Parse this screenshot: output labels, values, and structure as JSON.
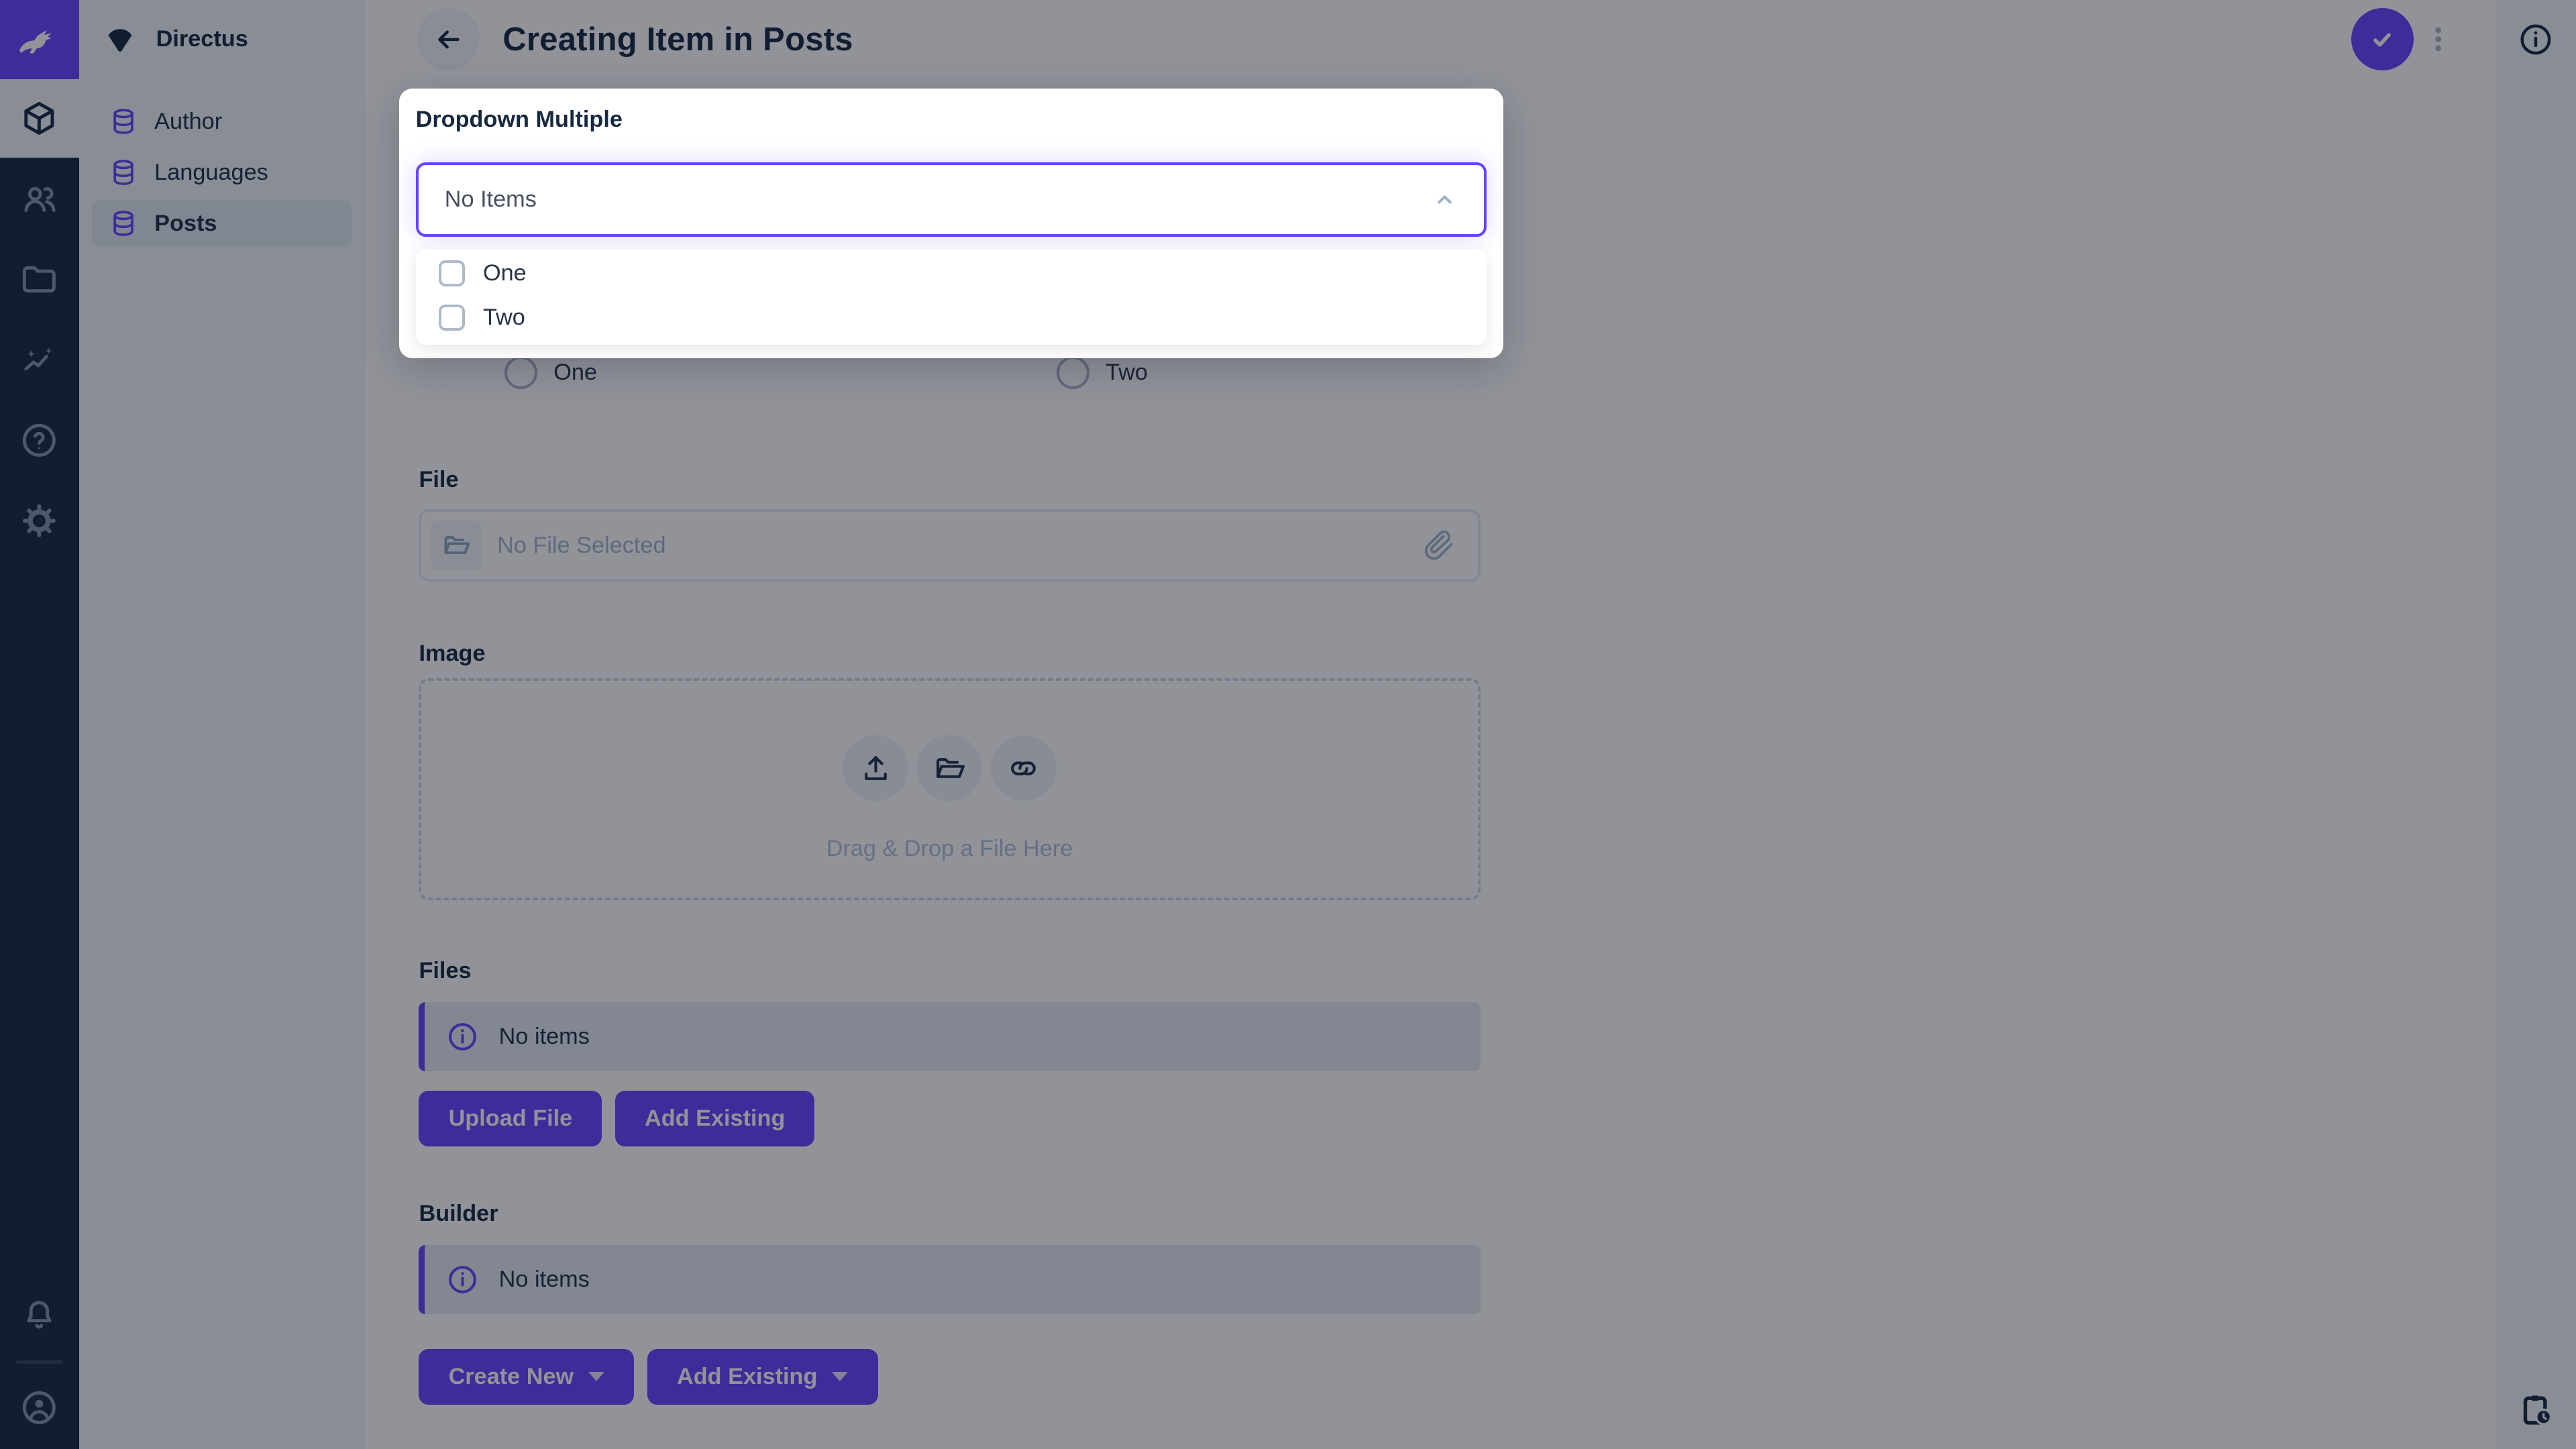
{
  "app": {
    "project_name": "Directus"
  },
  "sidebar": {
    "items": [
      {
        "label": "Author"
      },
      {
        "label": "Languages"
      },
      {
        "label": "Posts",
        "active": true
      }
    ]
  },
  "header": {
    "title": "Creating Item in Posts"
  },
  "popover": {
    "label": "Dropdown Multiple",
    "value": "No Items",
    "options": [
      {
        "label": "One"
      },
      {
        "label": "Two"
      }
    ]
  },
  "form": {
    "radio_left": {
      "label": "One"
    },
    "radio_right": {
      "label": "Two"
    },
    "file": {
      "label": "File",
      "placeholder": "No File Selected"
    },
    "image": {
      "label": "Image",
      "dropzone_text": "Drag & Drop a File Here"
    },
    "files": {
      "label": "Files",
      "notice": "No items",
      "buttons": [
        {
          "label": "Upload File"
        },
        {
          "label": "Add Existing"
        }
      ]
    },
    "builder": {
      "label": "Builder",
      "notice": "No items",
      "buttons": [
        {
          "label": "Create New"
        },
        {
          "label": "Add Existing"
        }
      ]
    }
  },
  "colors": {
    "accent": "#6644ff",
    "module_bar_bg": "#172940",
    "nav_bg": "#f0f4f9",
    "text": "#172940",
    "subdued_text": "#475063",
    "placeholder": "#a2b5cd",
    "border": "#e4eaf1",
    "notice_bg": "#e4eaf1",
    "checkbox_border": "#aebacc",
    "overlay": "rgba(10,16,29,0.45)"
  }
}
